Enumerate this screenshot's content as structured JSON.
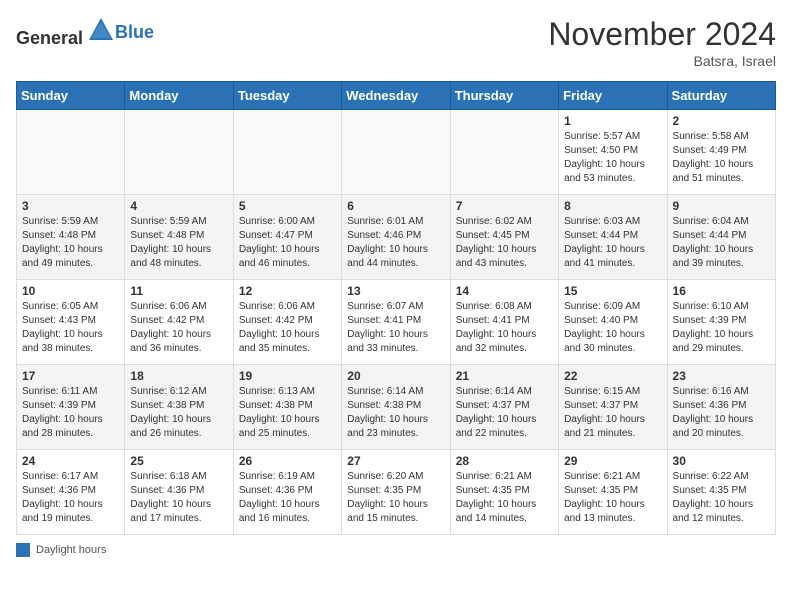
{
  "header": {
    "logo_general": "General",
    "logo_blue": "Blue",
    "month": "November 2024",
    "location": "Batsra, Israel"
  },
  "days_of_week": [
    "Sunday",
    "Monday",
    "Tuesday",
    "Wednesday",
    "Thursday",
    "Friday",
    "Saturday"
  ],
  "weeks": [
    [
      {
        "day": "",
        "info": ""
      },
      {
        "day": "",
        "info": ""
      },
      {
        "day": "",
        "info": ""
      },
      {
        "day": "",
        "info": ""
      },
      {
        "day": "",
        "info": ""
      },
      {
        "day": "1",
        "info": "Sunrise: 5:57 AM\nSunset: 4:50 PM\nDaylight: 10 hours and 53 minutes."
      },
      {
        "day": "2",
        "info": "Sunrise: 5:58 AM\nSunset: 4:49 PM\nDaylight: 10 hours and 51 minutes."
      }
    ],
    [
      {
        "day": "3",
        "info": "Sunrise: 5:59 AM\nSunset: 4:48 PM\nDaylight: 10 hours and 49 minutes."
      },
      {
        "day": "4",
        "info": "Sunrise: 5:59 AM\nSunset: 4:48 PM\nDaylight: 10 hours and 48 minutes."
      },
      {
        "day": "5",
        "info": "Sunrise: 6:00 AM\nSunset: 4:47 PM\nDaylight: 10 hours and 46 minutes."
      },
      {
        "day": "6",
        "info": "Sunrise: 6:01 AM\nSunset: 4:46 PM\nDaylight: 10 hours and 44 minutes."
      },
      {
        "day": "7",
        "info": "Sunrise: 6:02 AM\nSunset: 4:45 PM\nDaylight: 10 hours and 43 minutes."
      },
      {
        "day": "8",
        "info": "Sunrise: 6:03 AM\nSunset: 4:44 PM\nDaylight: 10 hours and 41 minutes."
      },
      {
        "day": "9",
        "info": "Sunrise: 6:04 AM\nSunset: 4:44 PM\nDaylight: 10 hours and 39 minutes."
      }
    ],
    [
      {
        "day": "10",
        "info": "Sunrise: 6:05 AM\nSunset: 4:43 PM\nDaylight: 10 hours and 38 minutes."
      },
      {
        "day": "11",
        "info": "Sunrise: 6:06 AM\nSunset: 4:42 PM\nDaylight: 10 hours and 36 minutes."
      },
      {
        "day": "12",
        "info": "Sunrise: 6:06 AM\nSunset: 4:42 PM\nDaylight: 10 hours and 35 minutes."
      },
      {
        "day": "13",
        "info": "Sunrise: 6:07 AM\nSunset: 4:41 PM\nDaylight: 10 hours and 33 minutes."
      },
      {
        "day": "14",
        "info": "Sunrise: 6:08 AM\nSunset: 4:41 PM\nDaylight: 10 hours and 32 minutes."
      },
      {
        "day": "15",
        "info": "Sunrise: 6:09 AM\nSunset: 4:40 PM\nDaylight: 10 hours and 30 minutes."
      },
      {
        "day": "16",
        "info": "Sunrise: 6:10 AM\nSunset: 4:39 PM\nDaylight: 10 hours and 29 minutes."
      }
    ],
    [
      {
        "day": "17",
        "info": "Sunrise: 6:11 AM\nSunset: 4:39 PM\nDaylight: 10 hours and 28 minutes."
      },
      {
        "day": "18",
        "info": "Sunrise: 6:12 AM\nSunset: 4:38 PM\nDaylight: 10 hours and 26 minutes."
      },
      {
        "day": "19",
        "info": "Sunrise: 6:13 AM\nSunset: 4:38 PM\nDaylight: 10 hours and 25 minutes."
      },
      {
        "day": "20",
        "info": "Sunrise: 6:14 AM\nSunset: 4:38 PM\nDaylight: 10 hours and 23 minutes."
      },
      {
        "day": "21",
        "info": "Sunrise: 6:14 AM\nSunset: 4:37 PM\nDaylight: 10 hours and 22 minutes."
      },
      {
        "day": "22",
        "info": "Sunrise: 6:15 AM\nSunset: 4:37 PM\nDaylight: 10 hours and 21 minutes."
      },
      {
        "day": "23",
        "info": "Sunrise: 6:16 AM\nSunset: 4:36 PM\nDaylight: 10 hours and 20 minutes."
      }
    ],
    [
      {
        "day": "24",
        "info": "Sunrise: 6:17 AM\nSunset: 4:36 PM\nDaylight: 10 hours and 19 minutes."
      },
      {
        "day": "25",
        "info": "Sunrise: 6:18 AM\nSunset: 4:36 PM\nDaylight: 10 hours and 17 minutes."
      },
      {
        "day": "26",
        "info": "Sunrise: 6:19 AM\nSunset: 4:36 PM\nDaylight: 10 hours and 16 minutes."
      },
      {
        "day": "27",
        "info": "Sunrise: 6:20 AM\nSunset: 4:35 PM\nDaylight: 10 hours and 15 minutes."
      },
      {
        "day": "28",
        "info": "Sunrise: 6:21 AM\nSunset: 4:35 PM\nDaylight: 10 hours and 14 minutes."
      },
      {
        "day": "29",
        "info": "Sunrise: 6:21 AM\nSunset: 4:35 PM\nDaylight: 10 hours and 13 minutes."
      },
      {
        "day": "30",
        "info": "Sunrise: 6:22 AM\nSunset: 4:35 PM\nDaylight: 10 hours and 12 minutes."
      }
    ]
  ],
  "footer": {
    "legend_label": "Daylight hours"
  }
}
